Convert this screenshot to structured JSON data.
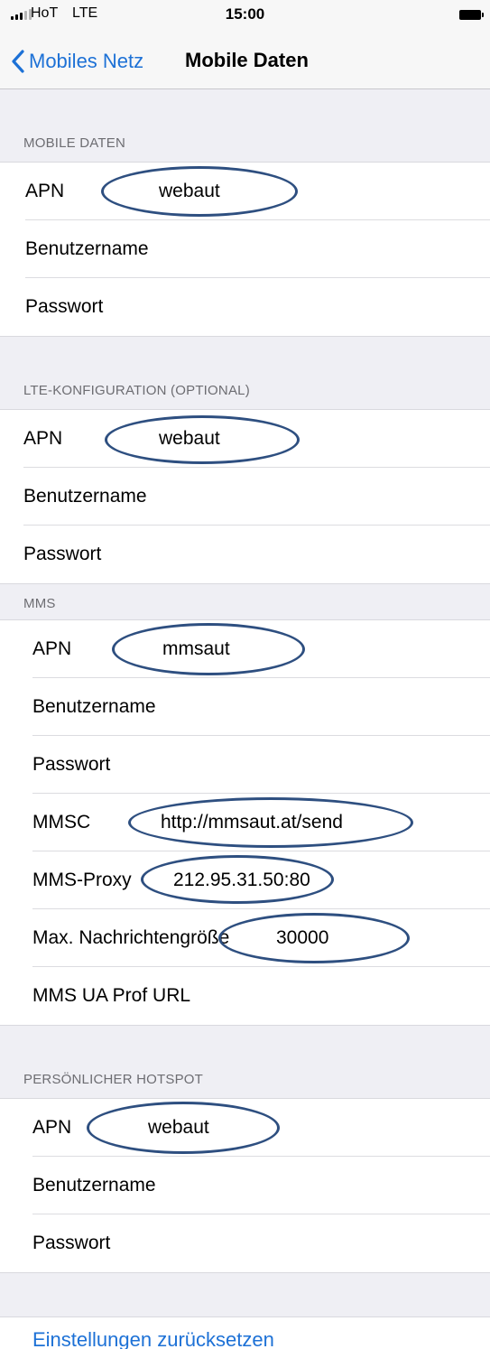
{
  "status_bar": {
    "carrier": "HoT",
    "network": "LTE",
    "time": "15:00",
    "icons": [
      "signal-icon",
      "battery-icon"
    ]
  },
  "nav": {
    "back_label": "Mobiles Netz",
    "title": "Mobile Daten"
  },
  "sections": {
    "mobile_data": {
      "header": "MOBILE DATEN",
      "rows": [
        {
          "label": "APN",
          "value": "webaut"
        },
        {
          "label": "Benutzername",
          "value": ""
        },
        {
          "label": "Passwort",
          "value": ""
        }
      ]
    },
    "lte": {
      "header": "LTE-KONFIGURATION (OPTIONAL)",
      "rows": [
        {
          "label": "APN",
          "value": "webaut"
        },
        {
          "label": "Benutzername",
          "value": ""
        },
        {
          "label": "Passwort",
          "value": ""
        }
      ]
    },
    "mms": {
      "header": "MMS",
      "rows": [
        {
          "label": "APN",
          "value": "mmsaut"
        },
        {
          "label": "Benutzername",
          "value": ""
        },
        {
          "label": "Passwort",
          "value": ""
        },
        {
          "label": "MMSC",
          "value": "http://mmsaut.at/send"
        },
        {
          "label": "MMS-Proxy",
          "value": "212.95.31.50:80"
        },
        {
          "label": "Max. Nachrichtengröße",
          "value": "30000"
        },
        {
          "label": "MMS UA Prof URL",
          "value": ""
        }
      ]
    },
    "hotspot": {
      "header": "PERSÖNLICHER HOTSPOT",
      "rows": [
        {
          "label": "APN",
          "value": "webaut"
        },
        {
          "label": "Benutzername",
          "value": ""
        },
        {
          "label": "Passwort",
          "value": ""
        }
      ]
    }
  },
  "reset_label": "Einstellungen zurücksetzen",
  "colors": {
    "accent": "#1d71d6",
    "annotation": "#2e4f80",
    "grouped_background": "#efeff4"
  }
}
